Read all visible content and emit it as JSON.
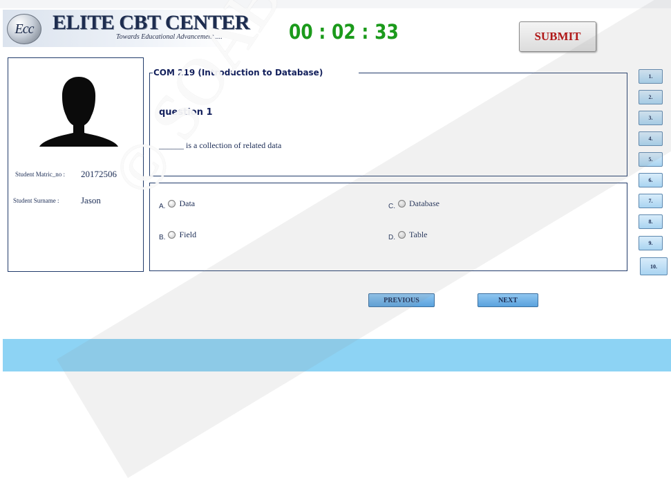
{
  "header": {
    "logo_text": "Ecc",
    "brand_name": "ELITE CBT CENTER",
    "tagline": "Towards Educational Advancement.....",
    "timer": "00 : 02 : 33",
    "submit_label": "SUBMIT"
  },
  "student": {
    "matric_label": "Student Matric_no :",
    "matric_value": "20172506",
    "surname_label": "Student Surname :",
    "surname_value": "Jason"
  },
  "question": {
    "course": "COM 219  (Introduction to Database)",
    "number": "question 1",
    "text": "______ is a collection of related data"
  },
  "options": [
    {
      "letter": "A.",
      "text": "Data",
      "selected": false
    },
    {
      "letter": "B.",
      "text": "Field",
      "selected": false
    },
    {
      "letter": "C.",
      "text": "Database",
      "selected": false
    },
    {
      "letter": "D.",
      "text": "Table",
      "selected": false
    }
  ],
  "question_nav": [
    "1.",
    "2.",
    "3.",
    "4.",
    "5.",
    "6.",
    "7.",
    "8.",
    "9.",
    "10."
  ],
  "navigation": {
    "previous_label": "PREVIOUS",
    "next_label": "NEXT"
  },
  "watermark": "© SOABOL TECH",
  "colors": {
    "timer": "#1b9a1b",
    "submit_text": "#b01818",
    "footer": "#8dd3f4",
    "nav_button": "#5aa2dd",
    "panel_border": "#203a6a"
  }
}
